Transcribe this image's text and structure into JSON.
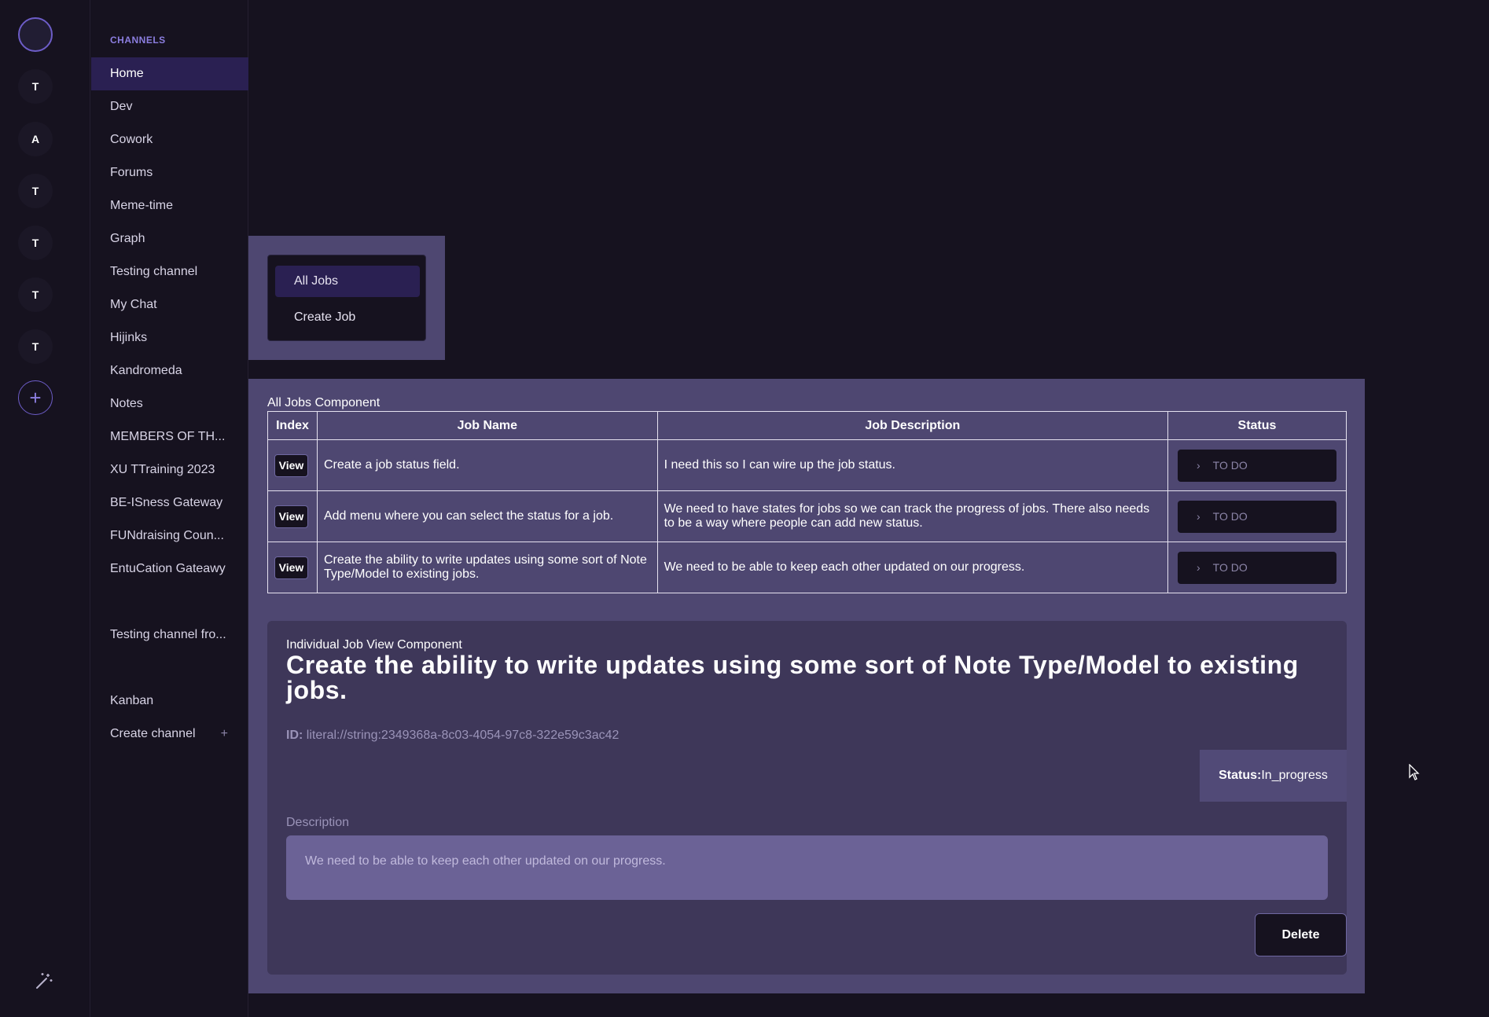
{
  "rail": {
    "servers": [
      "T",
      "A",
      "T",
      "T",
      "T",
      "T"
    ],
    "add_icon": "+",
    "home_icon": "home-avatar-icon",
    "bottom_icon": "magic-wand-icon"
  },
  "channels": {
    "header": "CHANNELS",
    "items": [
      "Home",
      "Dev",
      "Cowork",
      "Forums",
      "Meme-time",
      "Graph",
      "Testing channel",
      "My Chat",
      "Hijinks",
      "Kandromeda",
      "Notes",
      "MEMBERS OF TH...",
      "XU TTraining 2023",
      "BE-ISness Gateway",
      "FUNdraising Coun...",
      "EntuCation Gateawy"
    ],
    "extra_1": "Testing channel fro...",
    "kanban": "Kanban",
    "create": "Create channel",
    "create_icon": "+",
    "active": "Home"
  },
  "jobnav": {
    "all_jobs": "All Jobs",
    "create_job": "Create Job"
  },
  "all_jobs": {
    "component_label": "All Jobs Component",
    "columns": [
      "Index",
      "Job Name",
      "Job Description",
      "Status"
    ],
    "rows": [
      {
        "view": "View",
        "name": "Create a job status field.",
        "description": "I need this so I can wire up the job status.",
        "status": "TO DO"
      },
      {
        "view": "View",
        "name": "Add menu where you can select the status for a job.",
        "description": "We need to have states for jobs so we can track the progress of jobs. There also needs to be a way where people can add new status.",
        "status": "TO DO"
      },
      {
        "view": "View",
        "name": "Create the ability to write updates using some sort of Note Type/Model to existing jobs.",
        "description": "We need to be able to keep each other updated on our progress.",
        "status": "TO DO"
      }
    ],
    "status_chevron": "›"
  },
  "job_view": {
    "component_label": "Individual Job View Component",
    "title": "Create the ability to write updates using some sort of Note Type/Model to existing jobs.",
    "id_label": "ID:",
    "id_value": "literal://string:2349368a-8c03-4054-97c8-322e59c3ac42",
    "status_label": "Status:",
    "status_value": "In_progress",
    "description_label": "Description",
    "description": "We need to be able to keep each other updated on our progress.",
    "delete_label": "Delete"
  },
  "colors": {
    "background": "#16121f",
    "panel": "#4e4771",
    "active": "#2a2052",
    "accent": "#8c7ee0"
  }
}
